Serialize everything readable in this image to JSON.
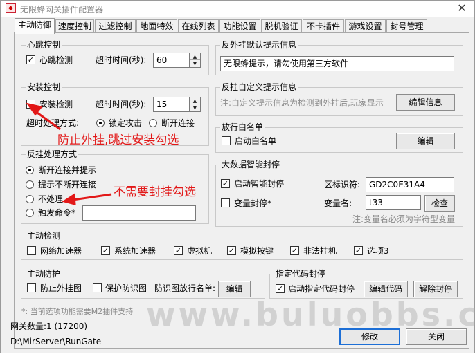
{
  "window": {
    "title": "无限蜂网关插件配置器",
    "close_glyph": "✕"
  },
  "tabs": [
    {
      "label": "主动防御",
      "active": true
    },
    {
      "label": "速度控制"
    },
    {
      "label": "过滤控制"
    },
    {
      "label": "地面特效"
    },
    {
      "label": "在线列表"
    },
    {
      "label": "功能设置"
    },
    {
      "label": "脱机验证"
    },
    {
      "label": "不卡插件"
    },
    {
      "label": "游戏设置"
    },
    {
      "label": "封号管理"
    }
  ],
  "heartbeat": {
    "legend": "心跳控制",
    "check_label": "心跳检测",
    "checked": true,
    "timeout_label": "超时时间(秒):",
    "timeout_value": "60"
  },
  "install": {
    "legend": "安装控制",
    "check_label": "安装检测",
    "checked": false,
    "timeout_label": "超时时间(秒):",
    "timeout_value": "15",
    "method_label": "超时处理方式:",
    "opt_lock": "锁定攻击",
    "opt_disconnect": "断开连接",
    "selected": "lock"
  },
  "cheat_handling": {
    "legend": "反挂处理方式",
    "options": [
      "断开连接并提示",
      "提示不断开连接",
      "不处理",
      "触发命令*"
    ],
    "selected_index": 0,
    "command_value": ""
  },
  "default_prompt": {
    "legend": "反外挂默认提示信息",
    "value": "无限蜂提示，请勿使用第三方软件"
  },
  "custom_prompt": {
    "legend": "反挂自定义提示信息",
    "hint": "注:自定义提示信息为检测到外挂后,玩家显示",
    "edit_button": "编辑信息"
  },
  "whitelist": {
    "legend": "放行白名单",
    "check_label": "启动白名单",
    "checked": false,
    "edit_button": "编辑"
  },
  "bigdata": {
    "legend": "大数据智能封停",
    "enable_label": "启动智能封停",
    "enable_checked": true,
    "id_label": "区标识符:",
    "id_value": "GD2C0E31A4",
    "var_check_label": "变量封停*",
    "var_checked": false,
    "var_name_label": "变量名:",
    "var_name_value": "t33",
    "check_button": "检查",
    "note": "注:变量名必须为字符型变量"
  },
  "active_detect": {
    "legend": "主动检测",
    "items": [
      {
        "label": "网络加速器",
        "checked": false
      },
      {
        "label": "系统加速器",
        "checked": true
      },
      {
        "label": "虚拟机",
        "checked": true
      },
      {
        "label": "模拟按键",
        "checked": true
      },
      {
        "label": "非法挂机",
        "checked": true
      },
      {
        "label": "选项3",
        "checked": true
      }
    ]
  },
  "active_protect": {
    "legend": "主动防护",
    "anti_cheat_label": "防止外挂图",
    "anti_cheat_checked": false,
    "protect_label": "保护防识图",
    "protect_checked": false,
    "release_label": "防识图放行名单:",
    "edit_button": "编辑"
  },
  "specified": {
    "legend": "指定代码封停",
    "enable_label": "启动指定代码封停",
    "enable_checked": true,
    "edit_button": "编辑代码",
    "unban_button": "解除封停"
  },
  "footer": {
    "note": "*: 当前选项功能需要M2插件支持",
    "gateway_count": "网关数量:1 (17200)",
    "path": "D:\\MirServer\\RunGate",
    "modify_button": "修改",
    "close_button": "关闭"
  },
  "annotations": {
    "install_hint": "防止外挂,跳过安装勾选",
    "no_handle_hint": "不需要封挂勾选",
    "color": "#e21818"
  },
  "watermark": "www.buluobbs.com"
}
